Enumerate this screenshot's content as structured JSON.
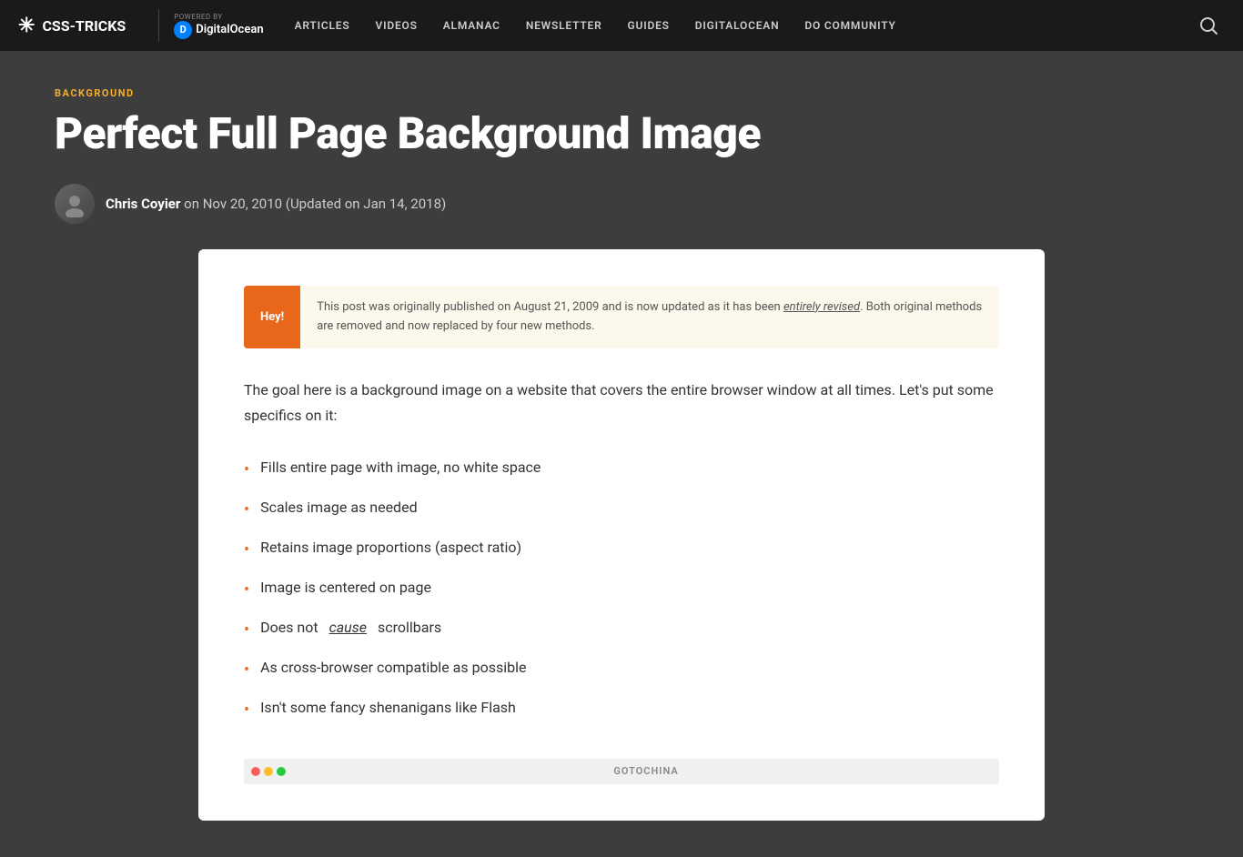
{
  "nav": {
    "logo_text": "CSS-TRICKS",
    "powered_by": "Powered by",
    "do_text": "DigitalOcean",
    "links": [
      {
        "label": "ARTICLES",
        "id": "articles"
      },
      {
        "label": "VIDEOS",
        "id": "videos"
      },
      {
        "label": "ALMANAC",
        "id": "almanac"
      },
      {
        "label": "NEWSLETTER",
        "id": "newsletter"
      },
      {
        "label": "GUIDES",
        "id": "guides"
      },
      {
        "label": "DIGITALOCEAN",
        "id": "digitalocean"
      },
      {
        "label": "DO COMMUNITY",
        "id": "do-community"
      }
    ]
  },
  "article": {
    "category": "BACKGROUND",
    "title": "Perfect Full Page Background Image",
    "author_name": "Chris Coyier",
    "author_date": "on Nov 20, 2010 (Updated on Jan 14, 2018)",
    "hey_label": "Hey!",
    "hey_text_before": "This post was originally published on August 21, 2009 and is now updated as it has been ",
    "hey_text_em": "entirely revised",
    "hey_text_after": ". Both original methods are removed and now replaced by four new methods.",
    "intro": "The goal here is a background image on a website that covers the entire browser window at all times. Let's put some specifics on it:",
    "bullets": [
      {
        "text": "Fills entire page with image, no white space",
        "has_italic": false
      },
      {
        "text": "Scales image as needed",
        "has_italic": false
      },
      {
        "text": "Retains image proportions (aspect ratio)",
        "has_italic": false
      },
      {
        "text": "Image is centered on page",
        "has_italic": false
      },
      {
        "text_before": "Does not ",
        "text_em": "cause",
        "text_after": " scrollbars",
        "has_italic": true
      },
      {
        "text": "As cross-browser compatible as possible",
        "has_italic": false
      },
      {
        "text": "Isn't some fancy shenanigans like Flash",
        "has_italic": false
      }
    ],
    "strip_label": "GOTOCHINA"
  }
}
